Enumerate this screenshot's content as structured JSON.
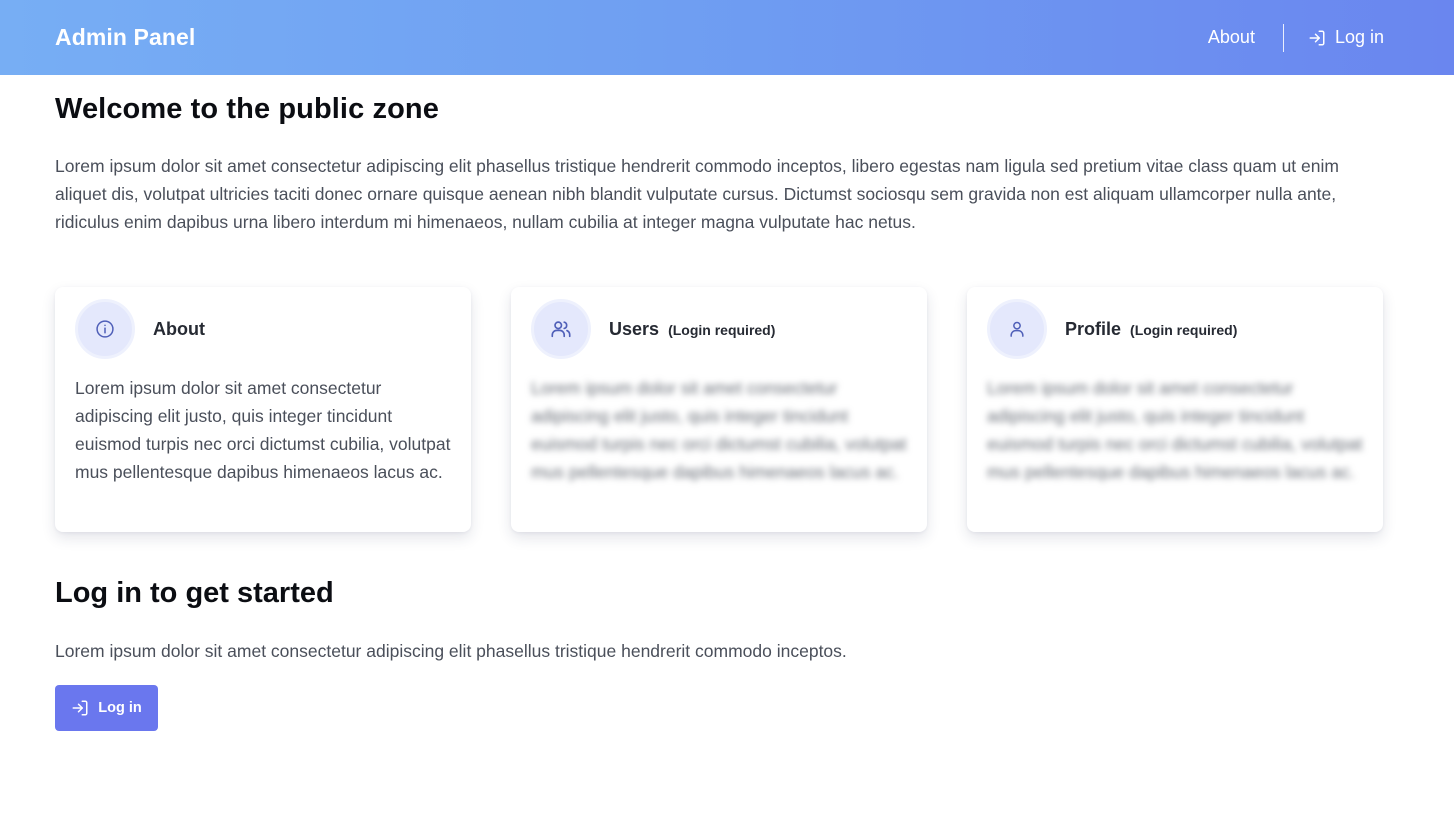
{
  "header": {
    "brand": "Admin Panel",
    "nav": {
      "about_label": "About",
      "login_label": "Log in",
      "login_icon": "login-icon"
    }
  },
  "main": {
    "title": "Welcome to the public zone",
    "intro": "Lorem ipsum dolor sit amet consectetur adipiscing elit phasellus tristique hendrerit commodo inceptos, libero egestas nam ligula sed pretium vitae class quam ut enim aliquet dis, volutpat ultricies taciti donec ornare quisque aenean nibh blandit vulputate cursus. Dictumst sociosqu sem gravida non est aliquam ullamcorper nulla ante, ridiculus enim dapibus urna libero interdum mi himenaeos, nullam cubilia at integer magna vulputate hac netus.",
    "cards": [
      {
        "icon": "info-icon",
        "title": "About",
        "note": "",
        "body": "Lorem ipsum dolor sit amet consectetur adipiscing elit justo, quis integer tincidunt euismod turpis nec orci dictumst cubilia, volutpat mus pellentesque dapibus himenaeos lacus ac.",
        "blurred": false
      },
      {
        "icon": "users-icon",
        "title": "Users",
        "note": "(Login required)",
        "body": "Lorem ipsum dolor sit amet consectetur adipiscing elit justo, quis integer tincidunt euismod turpis nec orci dictumst cubilia, volutpat mus pellentesque dapibus himenaeos lacus ac.",
        "blurred": true
      },
      {
        "icon": "user-icon",
        "title": "Profile",
        "note": "(Login required)",
        "body": "Lorem ipsum dolor sit amet consectetur adipiscing elit justo, quis integer tincidunt euismod turpis nec orci dictumst cubilia, volutpat mus pellentesque dapibus himenaeos lacus ac.",
        "blurred": true
      }
    ],
    "section_title": "Log in to get started",
    "section_text": "Lorem ipsum dolor sit amet consectetur adipiscing elit phasellus tristique hendrerit commodo inceptos.",
    "login_button": "Log in"
  },
  "colors": {
    "accent": "#6a77ee",
    "header_gradient_start": "#77aef4",
    "header_gradient_end": "#6a86ef",
    "icon_circle": "#e4e8fc",
    "icon_stroke": "#4f5fb8"
  }
}
